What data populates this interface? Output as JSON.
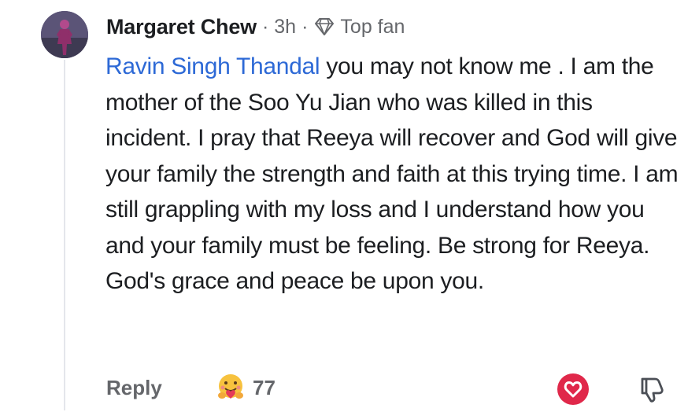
{
  "comment": {
    "author": "Margaret Chew",
    "separator_1": "·",
    "time": "3h",
    "separator_2": "·",
    "badge_icon": "diamond-icon",
    "badge_label": "Top fan",
    "mention": "Ravin Singh Thandal",
    "text": " you may not know me . I am the mother of the Soo Yu Jian who was killed in this incident. I pray that Reeya will recover and God will give your family the strength and faith at this trying time. I am still grappling with my loss and I understand how you and your family must be feeling. Be strong for Reeya. God's grace and peace be upon you."
  },
  "actions": {
    "reply_label": "Reply",
    "reaction_icon": "hug-emoji-icon",
    "reaction_count": "77",
    "like_icon": "heart-icon",
    "dislike_icon": "thumbs-down-icon"
  },
  "colors": {
    "mention": "#2d69d6",
    "meta": "#65676b",
    "heart": "#e0284a"
  }
}
